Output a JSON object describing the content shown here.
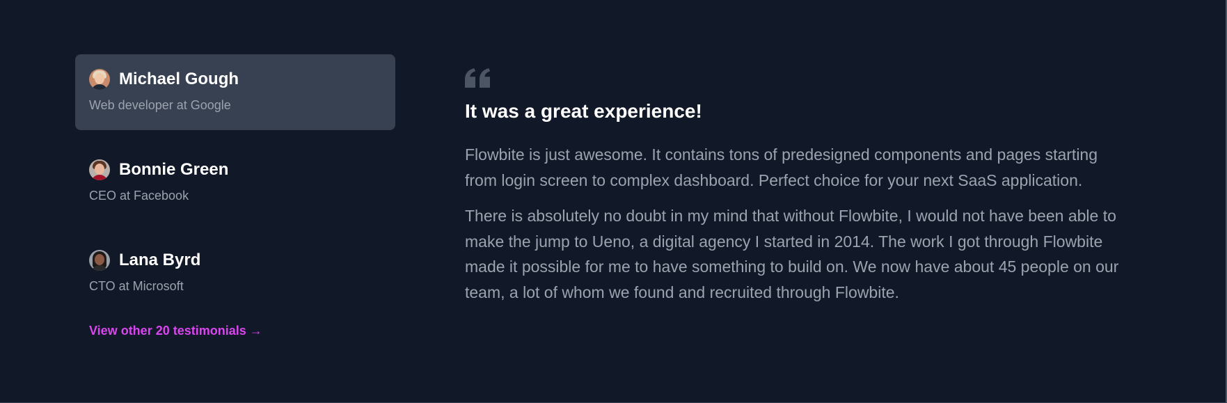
{
  "testimonials": [
    {
      "name": "Michael Gough",
      "role": "Web developer at Google",
      "active": true
    },
    {
      "name": "Bonnie Green",
      "role": "CEO at Facebook",
      "active": false
    },
    {
      "name": "Lana Byrd",
      "role": "CTO at Microsoft",
      "active": false
    }
  ],
  "more_link": "View other 20 testimonials →",
  "quote": {
    "headline": "It was a great experience!",
    "paragraph_1": "Flowbite is just awesome. It contains tons of predesigned components and pages starting from login screen to complex dashboard. Perfect choice for your next SaaS application.",
    "paragraph_2": "There is absolutely no doubt in my mind that without Flowbite, I would not have been able to make the jump to Ueno, a digital agency I started in 2014. The work I got through Flowbite made it possible for me to have something to build on. We now have about 45 people on our team, a lot of whom we found and recruited through Flowbite."
  },
  "icons": {
    "quote": "quote-icon",
    "avatar": "avatar-photo"
  },
  "colors": {
    "background": "#111827",
    "active_card": "#374151",
    "link": "#d946ef",
    "muted_text": "#9ca3af",
    "heading_text": "#ffffff"
  }
}
